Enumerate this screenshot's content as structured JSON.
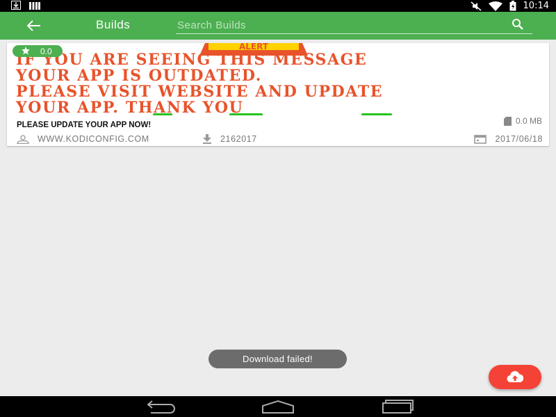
{
  "status_bar": {
    "time": "10:14",
    "icons": [
      "download-notification-icon",
      "signal-bars-icon",
      "mute-icon",
      "wifi-icon",
      "battery-icon"
    ]
  },
  "app_bar": {
    "title": "Builds",
    "search_placeholder": "Search Builds",
    "color": "#4caf50"
  },
  "build_card": {
    "rating": "0.0",
    "banner": {
      "sign_text": "ALERT",
      "lines": [
        "IF YOU ARE SEEING THIS MESSAGE",
        "YOUR APP IS OUTDATED.",
        "PLEASE VISIT WEBSITE AND UPDATE",
        "YOUR APP. THANK YOU"
      ]
    },
    "title": "PLEASE UPDATE YOUR APP NOW!",
    "size": "0.0 MB",
    "author": "WWW.KODICONFIG.COM",
    "downloads": "2162017",
    "date": "2017/06/18"
  },
  "toast": {
    "message": "Download failed!"
  },
  "fab": {
    "icon": "cloud-upload-icon",
    "color": "#f44336"
  },
  "nav_bar": {
    "icons": [
      "back-nav-icon",
      "home-nav-icon",
      "recents-nav-icon"
    ]
  }
}
